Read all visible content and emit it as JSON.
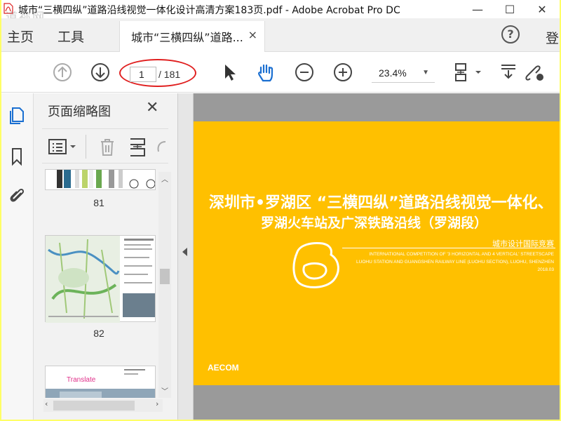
{
  "window": {
    "title": "城市“三横四纵”道路沿线视觉一体化设计高清方案183页.pdf - Adobe Acrobat Pro DC",
    "watermark": "道祢网",
    "controls": {
      "minimize": "—",
      "maximize": "☐",
      "close": "✕"
    }
  },
  "menu": {
    "home": "主页",
    "tools": "工具",
    "doc_tab": "城市“三横四纵”道路...",
    "doc_tab_close": "×",
    "help": "?",
    "login": "登"
  },
  "toolbar": {
    "page_current": "1",
    "page_total": "/ 181",
    "zoom": "23.4%",
    "zoom_caret": "▼"
  },
  "panel": {
    "title": "页面缩略图",
    "close": "✕",
    "thumbnails": [
      {
        "label": "81"
      },
      {
        "label": "82"
      },
      {
        "label": "",
        "caption": "Translate"
      }
    ]
  },
  "document": {
    "title_line1": "深圳市•罗湖区 “三横四纵”道路沿线视觉一体化、",
    "title_line2": "罗湖火车站及广深铁路沿线（罗湖段）",
    "competition_cn": "城市设计国际竞赛",
    "competition_en_1": "INTERNATIONAL COMPETITION OF '3 HORIZONTAL AND 4 VERTICAL' STREETSCAPE",
    "competition_en_2": "LUOHU STATION AND GUANGSHEN RAILWAY LINE (LUOHU SECTION), LUOHU, SHENZHEN",
    "competition_date": "2018.03",
    "brand": "AECOM",
    "page_color": "#ffc000"
  },
  "colors": {
    "accent": "#1a6fd1",
    "annotation": "#e02020",
    "outer_border": "#ffff66"
  }
}
